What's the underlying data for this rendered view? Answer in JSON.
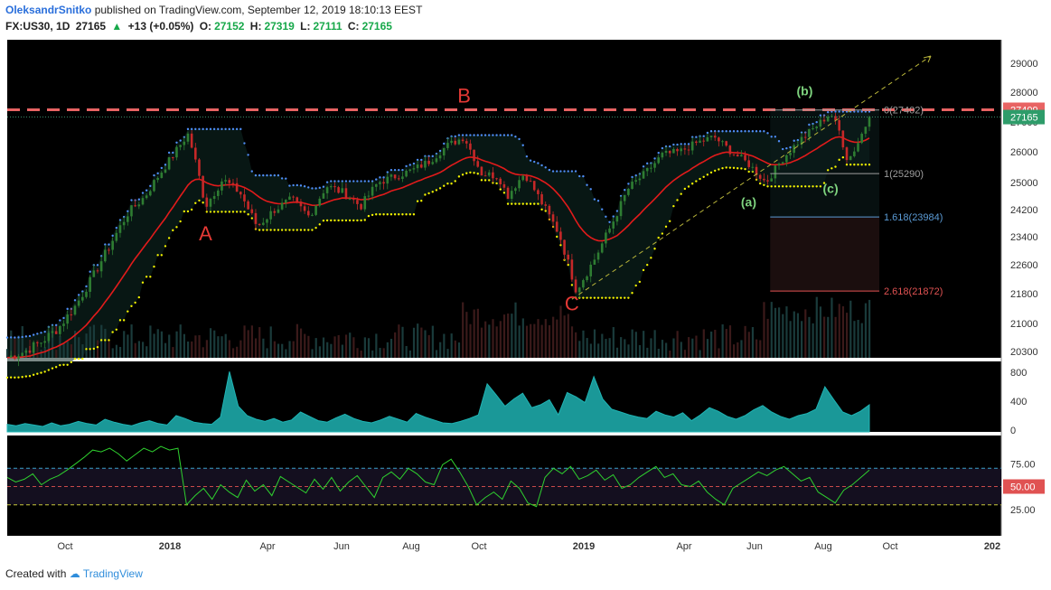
{
  "header": {
    "author": "OleksandrSnitko",
    "published": " published on TradingView.com, September 12, 2019 18:10:13 EEST",
    "symbol": "FX:US30, 1D",
    "last": "27165",
    "change_arrow": "▲",
    "change": "+13 (+0.05%)",
    "o_label": "O:",
    "o_value": "27152",
    "h_label": "H:",
    "h_value": "27319",
    "l_label": "L:",
    "l_value": "27111",
    "c_label": "C:",
    "c_value": "27165"
  },
  "footer": {
    "created_with": "Created with",
    "brand": "TradingView"
  },
  "colors": {
    "background": "#000000",
    "candle_up": "#2e7d32",
    "candle_down": "#c62828",
    "ema": "#e21b1b",
    "upper_band": "#4f8ef7",
    "lower_band": "#f5f500",
    "resistance": "#e86363",
    "trendline": "#b9b53a",
    "volume_area": "#1fb3b3",
    "rsi_line": "#2fd12f",
    "wave_label_major": "#e53935",
    "wave_label_minor": "#7ed37e",
    "fib_1618": "#5b9bd5",
    "fib_2618": "#e05252",
    "price_tag_current": "#2e9c6a",
    "price_tag_resistance": "#e86363"
  },
  "chart_data": [
    {
      "type": "candlestick",
      "panel": "price",
      "price_axis_ticks": [
        "29000",
        "28000",
        "27000",
        "26000",
        "25000",
        "24200",
        "23400",
        "22600",
        "21800",
        "21000",
        "20300"
      ],
      "price_axis_values": [
        29000,
        28000,
        27000,
        26000,
        25000,
        24200,
        23400,
        22600,
        21800,
        21000,
        20300
      ],
      "time_axis_labels": [
        "Oct",
        "2018",
        "Apr",
        "Jun",
        "Aug",
        "Oct",
        "2019",
        "Apr",
        "Jun",
        "Aug",
        "Oct",
        "202"
      ],
      "current_price": 27165,
      "resistance_level": 27409,
      "close_path": [
        {
          "t": 0,
          "v": 20150
        },
        {
          "t": 0.02,
          "v": 20300
        },
        {
          "t": 0.04,
          "v": 20550
        },
        {
          "t": 0.06,
          "v": 20900
        },
        {
          "t": 0.08,
          "v": 21500
        },
        {
          "t": 0.1,
          "v": 22300
        },
        {
          "t": 0.12,
          "v": 23200
        },
        {
          "t": 0.14,
          "v": 24100
        },
        {
          "t": 0.16,
          "v": 24600
        },
        {
          "t": 0.18,
          "v": 25400
        },
        {
          "t": 0.2,
          "v": 26200
        },
        {
          "t": 0.21,
          "v": 26600
        },
        {
          "t": 0.22,
          "v": 25500
        },
        {
          "t": 0.23,
          "v": 24300
        },
        {
          "t": 0.25,
          "v": 25100
        },
        {
          "t": 0.27,
          "v": 24700
        },
        {
          "t": 0.29,
          "v": 23700
        },
        {
          "t": 0.31,
          "v": 24200
        },
        {
          "t": 0.33,
          "v": 24500
        },
        {
          "t": 0.35,
          "v": 24000
        },
        {
          "t": 0.37,
          "v": 24900
        },
        {
          "t": 0.39,
          "v": 24700
        },
        {
          "t": 0.41,
          "v": 24300
        },
        {
          "t": 0.43,
          "v": 25000
        },
        {
          "t": 0.45,
          "v": 25200
        },
        {
          "t": 0.47,
          "v": 25400
        },
        {
          "t": 0.49,
          "v": 25700
        },
        {
          "t": 0.51,
          "v": 26200
        },
        {
          "t": 0.53,
          "v": 26500
        },
        {
          "t": 0.55,
          "v": 25300
        },
        {
          "t": 0.57,
          "v": 25200
        },
        {
          "t": 0.58,
          "v": 24600
        },
        {
          "t": 0.6,
          "v": 25300
        },
        {
          "t": 0.62,
          "v": 24400
        },
        {
          "t": 0.64,
          "v": 23500
        },
        {
          "t": 0.66,
          "v": 21900
        },
        {
          "t": 0.68,
          "v": 22700
        },
        {
          "t": 0.7,
          "v": 23700
        },
        {
          "t": 0.72,
          "v": 24800
        },
        {
          "t": 0.74,
          "v": 25300
        },
        {
          "t": 0.76,
          "v": 25900
        },
        {
          "t": 0.78,
          "v": 26000
        },
        {
          "t": 0.8,
          "v": 26300
        },
        {
          "t": 0.82,
          "v": 26500
        },
        {
          "t": 0.84,
          "v": 26000
        },
        {
          "t": 0.86,
          "v": 25600
        },
        {
          "t": 0.88,
          "v": 25000
        },
        {
          "t": 0.9,
          "v": 25800
        },
        {
          "t": 0.92,
          "v": 26400
        },
        {
          "t": 0.94,
          "v": 26900
        },
        {
          "t": 0.955,
          "v": 27300
        },
        {
          "t": 0.965,
          "v": 26700
        },
        {
          "t": 0.975,
          "v": 25700
        },
        {
          "t": 0.985,
          "v": 26200
        },
        {
          "t": 1.0,
          "v": 27165
        }
      ],
      "wave_labels": [
        {
          "label": "A",
          "t": 0.23,
          "v": 23300,
          "style": "major"
        },
        {
          "label": "B",
          "t": 0.53,
          "v": 27650,
          "style": "major"
        },
        {
          "label": "C",
          "t": 0.655,
          "v": 21350,
          "style": "major"
        },
        {
          "label": "(a)",
          "t": 0.86,
          "v": 24300,
          "style": "minor"
        },
        {
          "label": "(b)",
          "t": 0.925,
          "v": 27900,
          "style": "minor"
        },
        {
          "label": "(c)",
          "t": 0.955,
          "v": 24700,
          "style": "minor"
        }
      ],
      "fib_levels": [
        {
          "label": "0(27402)",
          "value": 27402
        },
        {
          "label": "1(25290)",
          "value": 25290
        },
        {
          "label": "1.618(23984)",
          "value": 23984
        },
        {
          "label": "2.618(21872)",
          "value": 21872
        }
      ],
      "price_tags": [
        {
          "value": 27409,
          "label": "27409",
          "kind": "resistance"
        },
        {
          "value": 27165,
          "label": "27165",
          "kind": "current"
        }
      ]
    },
    {
      "type": "area",
      "panel": "volume",
      "axis_ticks": [
        "800",
        "400",
        "0"
      ],
      "axis_values": [
        800,
        400,
        0
      ],
      "values": [
        80,
        60,
        90,
        70,
        50,
        100,
        60,
        80,
        120,
        90,
        70,
        150,
        110,
        80,
        60,
        100,
        130,
        90,
        70,
        200,
        160,
        110,
        90,
        80,
        180,
        810,
        330,
        200,
        150,
        120,
        160,
        110,
        140,
        250,
        190,
        130,
        110,
        170,
        220,
        160,
        120,
        100,
        140,
        190,
        150,
        110,
        230,
        180,
        140,
        100,
        90,
        120,
        160,
        210,
        640,
        490,
        330,
        430,
        510,
        310,
        350,
        420,
        210,
        520,
        460,
        380,
        740,
        430,
        290,
        250,
        210,
        180,
        160,
        260,
        210,
        180,
        240,
        130,
        210,
        310,
        260,
        190,
        150,
        200,
        280,
        340,
        250,
        190,
        150,
        200,
        230,
        290,
        600,
        420,
        250,
        200,
        260,
        350
      ]
    },
    {
      "type": "line",
      "panel": "rsi",
      "axis_ticks": [
        "75.00",
        "50.00",
        "25.00"
      ],
      "axis_values": [
        75,
        50,
        25
      ],
      "rsi_current_label": "50.00",
      "bands": [
        70,
        50,
        30
      ],
      "values": [
        60,
        55,
        58,
        64,
        52,
        58,
        62,
        68,
        75,
        82,
        90,
        88,
        92,
        86,
        78,
        85,
        92,
        88,
        94,
        90,
        92,
        30,
        40,
        48,
        36,
        52,
        44,
        38,
        57,
        45,
        52,
        40,
        61,
        55,
        49,
        43,
        58,
        47,
        60,
        45,
        55,
        62,
        50,
        38,
        60,
        66,
        58,
        70,
        64,
        55,
        52,
        74,
        80,
        66,
        50,
        30,
        38,
        44,
        36,
        56,
        48,
        32,
        28,
        60,
        70,
        64,
        72,
        58,
        62,
        68,
        57,
        63,
        48,
        52,
        60,
        66,
        72,
        60,
        64,
        52,
        50,
        56,
        44,
        36,
        30,
        48,
        54,
        60,
        66,
        62,
        68,
        72,
        64,
        56,
        60,
        44,
        38,
        32,
        46,
        52,
        60,
        68
      ]
    }
  ]
}
